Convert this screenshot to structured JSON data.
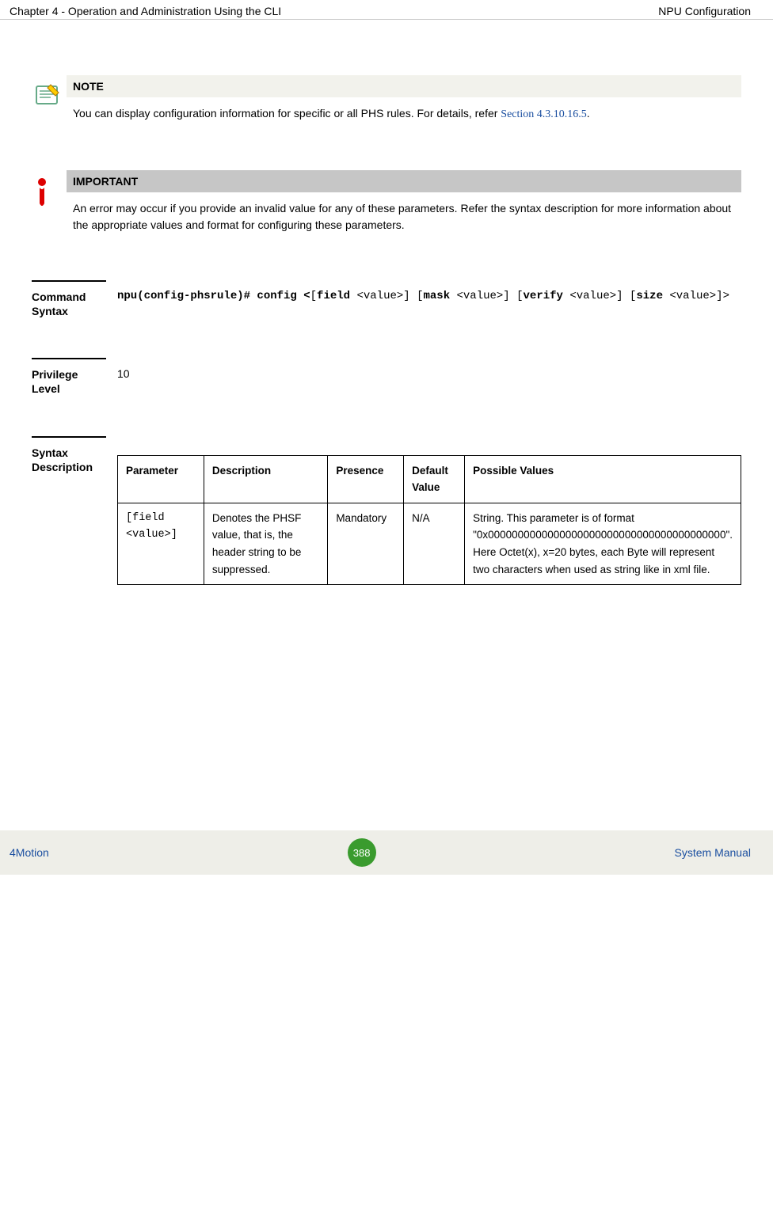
{
  "header": {
    "left": "Chapter 4 - Operation and Administration Using the CLI",
    "right": "NPU Configuration"
  },
  "note": {
    "title": "NOTE",
    "text_pre": "You can display configuration information for specific or all PHS rules. For details, refer ",
    "link": "Section 4.3.10.16.5",
    "after": "."
  },
  "important": {
    "title": "IMPORTANT",
    "text": "An error may occur if you provide an invalid value for any of these parameters. Refer the syntax description for more information about the appropriate values and format for configuring these parameters."
  },
  "cmd": {
    "label": "Command Syntax",
    "p1": "npu(config-phsrule)# config <",
    "p2": "[",
    "p3": "field",
    "p4": " <value>] [",
    "p5": "mask",
    "p6": " <value>] [",
    "p7": "verify",
    "p8": " <value>] [",
    "p9": "size",
    "p10": " <value>]>"
  },
  "priv": {
    "label": "Privilege Level",
    "value": "10"
  },
  "syntax": {
    "label": "Syntax Description",
    "headers": {
      "param": "Parameter",
      "desc": "Description",
      "presence": "Presence",
      "default": "Default Value",
      "possible": "Possible Values"
    },
    "row1": {
      "param": "[field <value>]",
      "desc": "Denotes the PHSF value, that is, the header string to be suppressed.",
      "presence": "Mandatory",
      "default": "N/A",
      "possible": "String. This parameter is of format \"0x0000000000000000000000000000000000000000\". Here Octet(x), x=20 bytes, each Byte will represent two characters when used as string like in xml file."
    }
  },
  "footer": {
    "left": "4Motion",
    "page": "388",
    "right": "System Manual"
  }
}
